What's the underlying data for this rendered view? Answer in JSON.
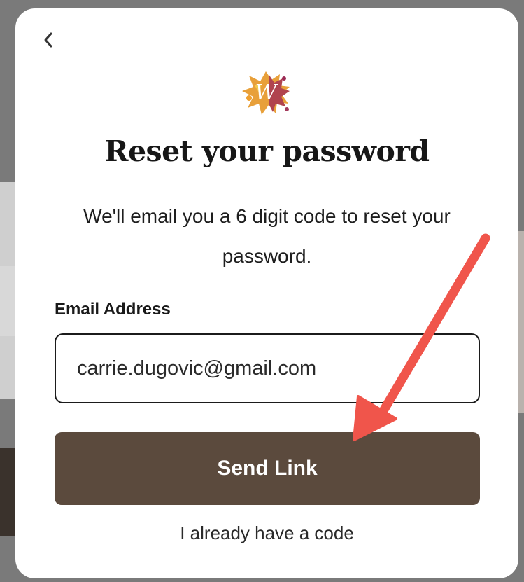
{
  "dialog": {
    "title": "Reset your password",
    "subtitle": "We'll email you a 6 digit code to reset your password.",
    "back_icon": "chevron-left-icon",
    "logo_icon": "w-splash-logo-icon"
  },
  "form": {
    "email_label": "Email Address",
    "email_value": "carrie.dugovic@gmail.com",
    "submit_label": "Send Link",
    "alt_link": "I already have a code"
  },
  "colors": {
    "button_bg": "#5b4a3d",
    "annotation_arrow": "#f0554b"
  }
}
